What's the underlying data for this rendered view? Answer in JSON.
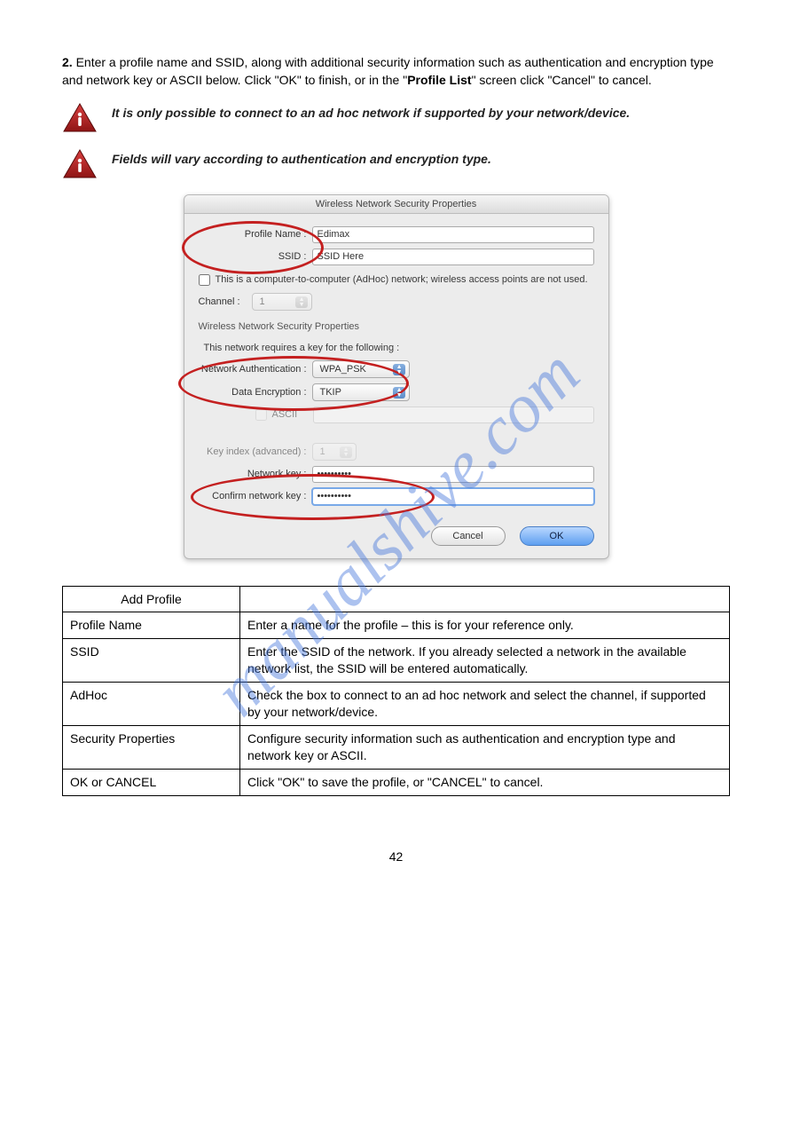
{
  "page_number": "42",
  "watermark_text": "manualshive.com",
  "step": {
    "num": "2.",
    "text_a": "Enter a profile name and SSID, along with additional security information such as authentication and encryption type and network key or ASCII below. Click \"OK\" to finish, or in the \"",
    "profile_list_quoted": "Profile List",
    "text_b": "\" screen click \"Cancel\" to cancel."
  },
  "note1": "It is only possible to connect to an ad hoc network if supported by your network/device.",
  "note2": "Fields will vary according to authentication and encryption type.",
  "dialog": {
    "title": "Wireless Network Security Properties",
    "labels": {
      "profile_name": "Profile Name :",
      "ssid": "SSID :",
      "adhoc": "This is a computer-to-computer (AdHoc) network; wireless access points are not used.",
      "channel": "Channel :",
      "section": "Wireless Network Security Properties",
      "requires": "This network requires a key for the following :",
      "auth": "Network Authentication :",
      "enc": "Data Encryption :",
      "ascii": "ASCII",
      "key_index": "Key index (advanced) :",
      "net_key": "Network key :",
      "confirm_key": "Confirm network key :"
    },
    "values": {
      "profile_name": "Edimax",
      "ssid": "SSID Here",
      "channel": "1",
      "auth": "WPA_PSK",
      "enc": "TKIP",
      "key_index": "1",
      "net_key": "••••••••••",
      "confirm_key": "••••••••••"
    },
    "buttons": {
      "cancel": "Cancel",
      "ok": "OK"
    }
  },
  "table": {
    "headers": [
      "Add Profile",
      ""
    ],
    "rows": [
      [
        "Profile Name",
        "Enter a name for the profile – this is for your reference only."
      ],
      [
        "SSID",
        "Enter the SSID of the network. If you already selected a network in the available network list, the SSID will be entered automatically."
      ],
      [
        "AdHoc",
        "Check the box to connect to an ad hoc network and select the channel, if supported by your network/device."
      ],
      [
        "Security Properties",
        "Configure security information such as authentication and encryption type and network key or ASCII."
      ],
      [
        "OK or CANCEL",
        "Click \"OK\" to save the profile, or \"CANCEL\" to cancel."
      ]
    ]
  }
}
